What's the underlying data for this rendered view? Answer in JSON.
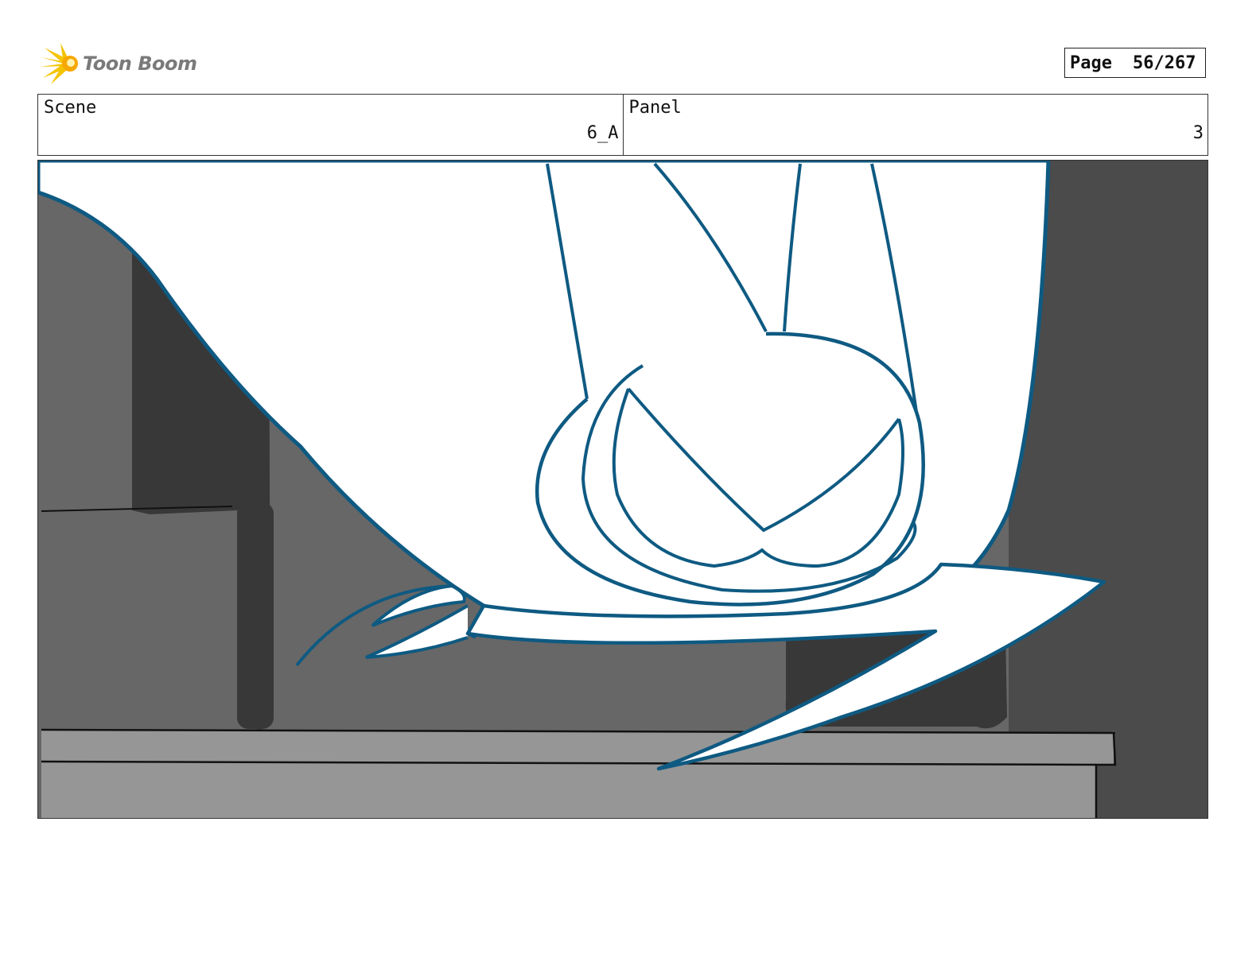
{
  "header": {
    "logo_text": "Toon Boom",
    "page_label": "Page",
    "page_number": "56/267"
  },
  "info": {
    "scene_label": "Scene",
    "scene_value": "6_A",
    "panel_label": "Panel",
    "panel_value": "3"
  },
  "colors": {
    "line": "#0e5a82",
    "wall_mid": "#676767",
    "shadow": "#383838",
    "wall_right": "#4b4b4b",
    "table": "#969696"
  }
}
